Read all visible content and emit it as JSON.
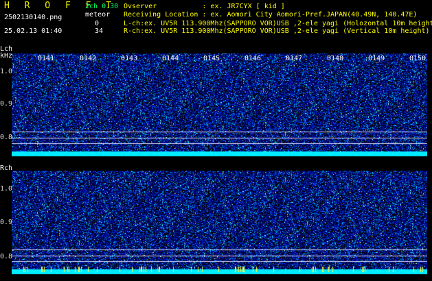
{
  "header": {
    "title": "H R O F F T",
    "version": "2ch 0.30",
    "filename": "2502130140.png",
    "meteor_label": "meteor",
    "datetime": "25.02.13 01:40",
    "count_l": "0",
    "count_r": "34"
  },
  "info": {
    "observer": "Ovserver           : ex. JR7CYX [ kid ]",
    "location": "Receiving Location : ex. Aomori City Aomori-Pref.JAPAN(40.49N, 140.47E)",
    "lch": "L-ch:ex. UV5R 113.900Mhz(SAPPORO VOR)USB ,2-ele yagi (Holozontal 10m height)",
    "rch": "R-ch:ex. UV5R 113.900Mhz(SAPPORO VOR)USB ,2-ele yagi (Vertical 10m height)"
  },
  "channels": {
    "lch_label": "Lch",
    "khz_label": "kHz",
    "rch_label": "Rch"
  },
  "time_ticks": [
    "0141",
    "0142",
    "0143",
    "0144",
    "0145",
    "0146",
    "0147",
    "0148",
    "0149",
    "0150"
  ],
  "freq_ticks": [
    "1.0",
    "0.9",
    "0.8"
  ],
  "colors": {
    "background": "#000000",
    "title": "#f0f000",
    "version": "#00ff66",
    "info_text": "#ffff00",
    "label_text": "#ffffff",
    "noise_band": "#00e5ff",
    "reference_line": "#dcdcff",
    "meteor_mark": "#ffff40"
  }
}
